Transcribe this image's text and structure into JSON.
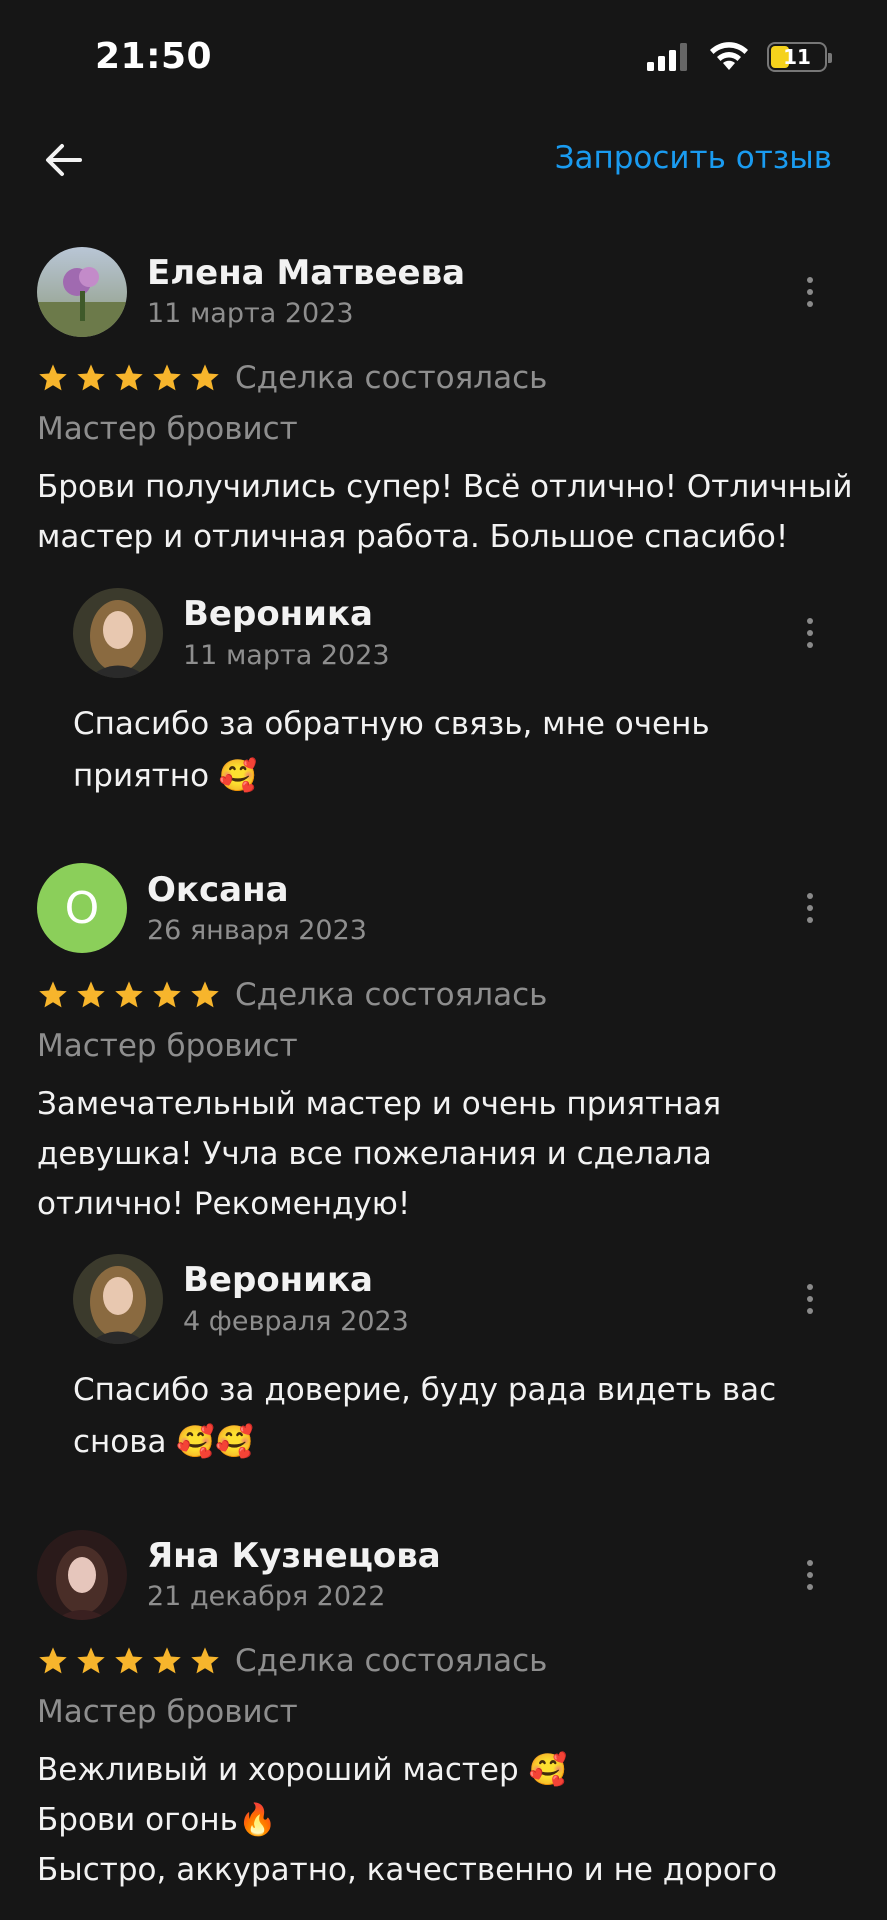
{
  "status_bar": {
    "time": "21:50",
    "battery": "11"
  },
  "header": {
    "request_review": "Запросить отзыв"
  },
  "reviews": [
    {
      "author": "Елена Матвеева",
      "date": "11 марта 2023",
      "deal_status": "Сделка состоялась",
      "service": "Мастер бровист",
      "text": "Брови получились супер! Всё отлично! Отличный\nмастер и отличная работа. Большое спасибо!",
      "reply": {
        "author": "Вероника",
        "date": "11 марта 2023",
        "text": "Спасибо за обратную связь, мне очень\nприятно 🥰"
      }
    },
    {
      "author": "Оксана",
      "avatar_letter": "О",
      "date": "26 января 2023",
      "deal_status": "Сделка состоялась",
      "service": "Мастер бровист",
      "text": "Замечательный мастер и очень приятная\nдевушка! Учла все пожелания и сделала\nотлично! Рекомендую!",
      "reply": {
        "author": "Вероника",
        "date": "4 февраля 2023",
        "text": "Спасибо за доверие,  буду рада видеть вас\nснова 🥰🥰"
      }
    },
    {
      "author": "Яна Кузнецова",
      "date": "21 декабря 2022",
      "deal_status": "Сделка состоялась",
      "service": "Мастер бровист",
      "text": "Вежливый и хороший мастер 🥰\nБрови огонь🔥\nБыстро, аккуратно, качественно и не дорого"
    }
  ],
  "colors": {
    "accent": "#1a9bf0",
    "star": "#f7b52c",
    "background": "#161616",
    "muted": "#8e8e8e"
  },
  "rating_stars": 5
}
